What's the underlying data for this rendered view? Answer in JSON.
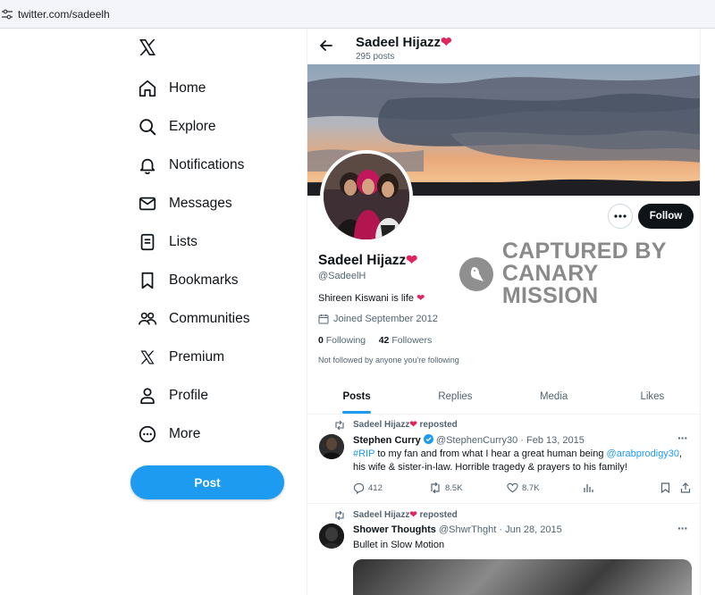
{
  "browser": {
    "url": "twitter.com/sadeelh"
  },
  "nav": {
    "items": [
      {
        "label": "Home",
        "icon": "home-icon"
      },
      {
        "label": "Explore",
        "icon": "search-icon"
      },
      {
        "label": "Notifications",
        "icon": "bell-icon"
      },
      {
        "label": "Messages",
        "icon": "envelope-icon"
      },
      {
        "label": "Lists",
        "icon": "list-icon"
      },
      {
        "label": "Bookmarks",
        "icon": "bookmark-icon"
      },
      {
        "label": "Communities",
        "icon": "people-icon"
      },
      {
        "label": "Premium",
        "icon": "x-logo-icon"
      },
      {
        "label": "Profile",
        "icon": "person-icon"
      },
      {
        "label": "More",
        "icon": "more-circle-icon"
      }
    ],
    "post_label": "Post"
  },
  "header": {
    "name": "Sadeel Hijazz",
    "posts_count": "295 posts"
  },
  "profile": {
    "name": "Sadeel Hijazz",
    "heart": "❤",
    "handle": "@SadeelH",
    "bio": "Shireen Kiswani is life",
    "joined": "Joined September 2012",
    "following_count": "0",
    "following_label": "Following",
    "followers_count": "42",
    "followers_label": "Followers",
    "not_followed": "Not followed by anyone you're following",
    "follow_label": "Follow"
  },
  "watermark": {
    "line1": "CAPTURED BY",
    "line2": "CANARY MISSION"
  },
  "tabs": [
    "Posts",
    "Replies",
    "Media",
    "Likes"
  ],
  "active_tab": "Posts",
  "tweets": [
    {
      "repost_by": "Sadeel Hijazz",
      "repost_suffix": "reposted",
      "author": "Stephen Curry",
      "verified": true,
      "handle": "@StephenCurry30",
      "date": "Feb 13, 2015",
      "text_tag": "#RIP",
      "text_mid": "to my fan and from what I hear a great human being",
      "text_mention": "@arabprodigy30",
      "text_end": "his wife & sister-in-law. Horrible tragedy & prayers to his family!",
      "replies": "412",
      "retweets": "8.5K",
      "likes": "8.7K"
    },
    {
      "repost_by": "Sadeel Hijazz",
      "repost_suffix": "reposted",
      "author": "Shower Thoughts",
      "handle": "@ShwrThght",
      "date": "Jun 28, 2015",
      "text": "Bullet in Slow Motion"
    }
  ],
  "colors": {
    "accent": "#1d9bf0",
    "heart": "#e0245e",
    "text": "#0f1419",
    "muted": "#536471"
  }
}
